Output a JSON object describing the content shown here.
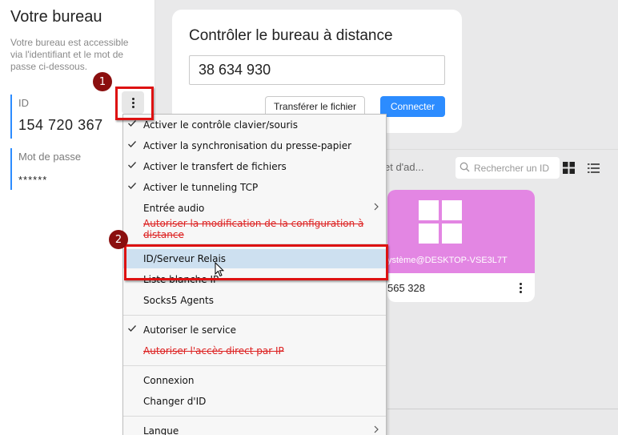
{
  "sidebar": {
    "title": "Votre bureau",
    "description": "Votre bureau est accessible via l'identifiant et le mot de passe ci-dessous.",
    "id_label": "ID",
    "id_value": "154 720 367",
    "password_label": "Mot de passe",
    "password_value": "******"
  },
  "remote": {
    "title": "Contrôler le bureau à distance",
    "id_input_value": "38 634 930",
    "transfer_button": "Transférer le fichier",
    "connect_button": "Connecter"
  },
  "peers": {
    "tab_partial": "et d'ad...",
    "search_placeholder": "Rechercher un ID",
    "card": {
      "hostname": "ystème@DESKTOP-VSE3L7T",
      "id": "565 328"
    }
  },
  "menu": {
    "items": [
      {
        "label": "Activer le contrôle clavier/souris",
        "checked": true
      },
      {
        "label": "Activer la synchronisation du presse-papier",
        "checked": true
      },
      {
        "label": "Activer le transfert de fichiers",
        "checked": true
      },
      {
        "label": "Activer le tunneling TCP",
        "checked": true
      },
      {
        "label": "Entrée audio",
        "submenu": true
      },
      {
        "label": "Autoriser la modification de la configuration à distance",
        "disabled": true
      },
      {
        "label": "ID/Serveur Relais",
        "highlighted": true
      },
      {
        "label": "Liste blanche IP"
      },
      {
        "label": "Socks5 Agents"
      },
      {
        "label": "Autoriser le service",
        "checked": true
      },
      {
        "label": "Autoriser l'accès direct par IP",
        "disabled": true
      },
      {
        "label": "Connexion"
      },
      {
        "label": "Changer d'ID"
      },
      {
        "label": "Langue",
        "submenu": true
      }
    ]
  },
  "annotations": {
    "step1": "1",
    "step2": "2"
  },
  "colors": {
    "accent": "#2c8cff",
    "annotation_red": "#dd1111",
    "badge": "#8b0f0f",
    "peer_thumb": "#e386e3",
    "highlight": "#cde0f0"
  }
}
